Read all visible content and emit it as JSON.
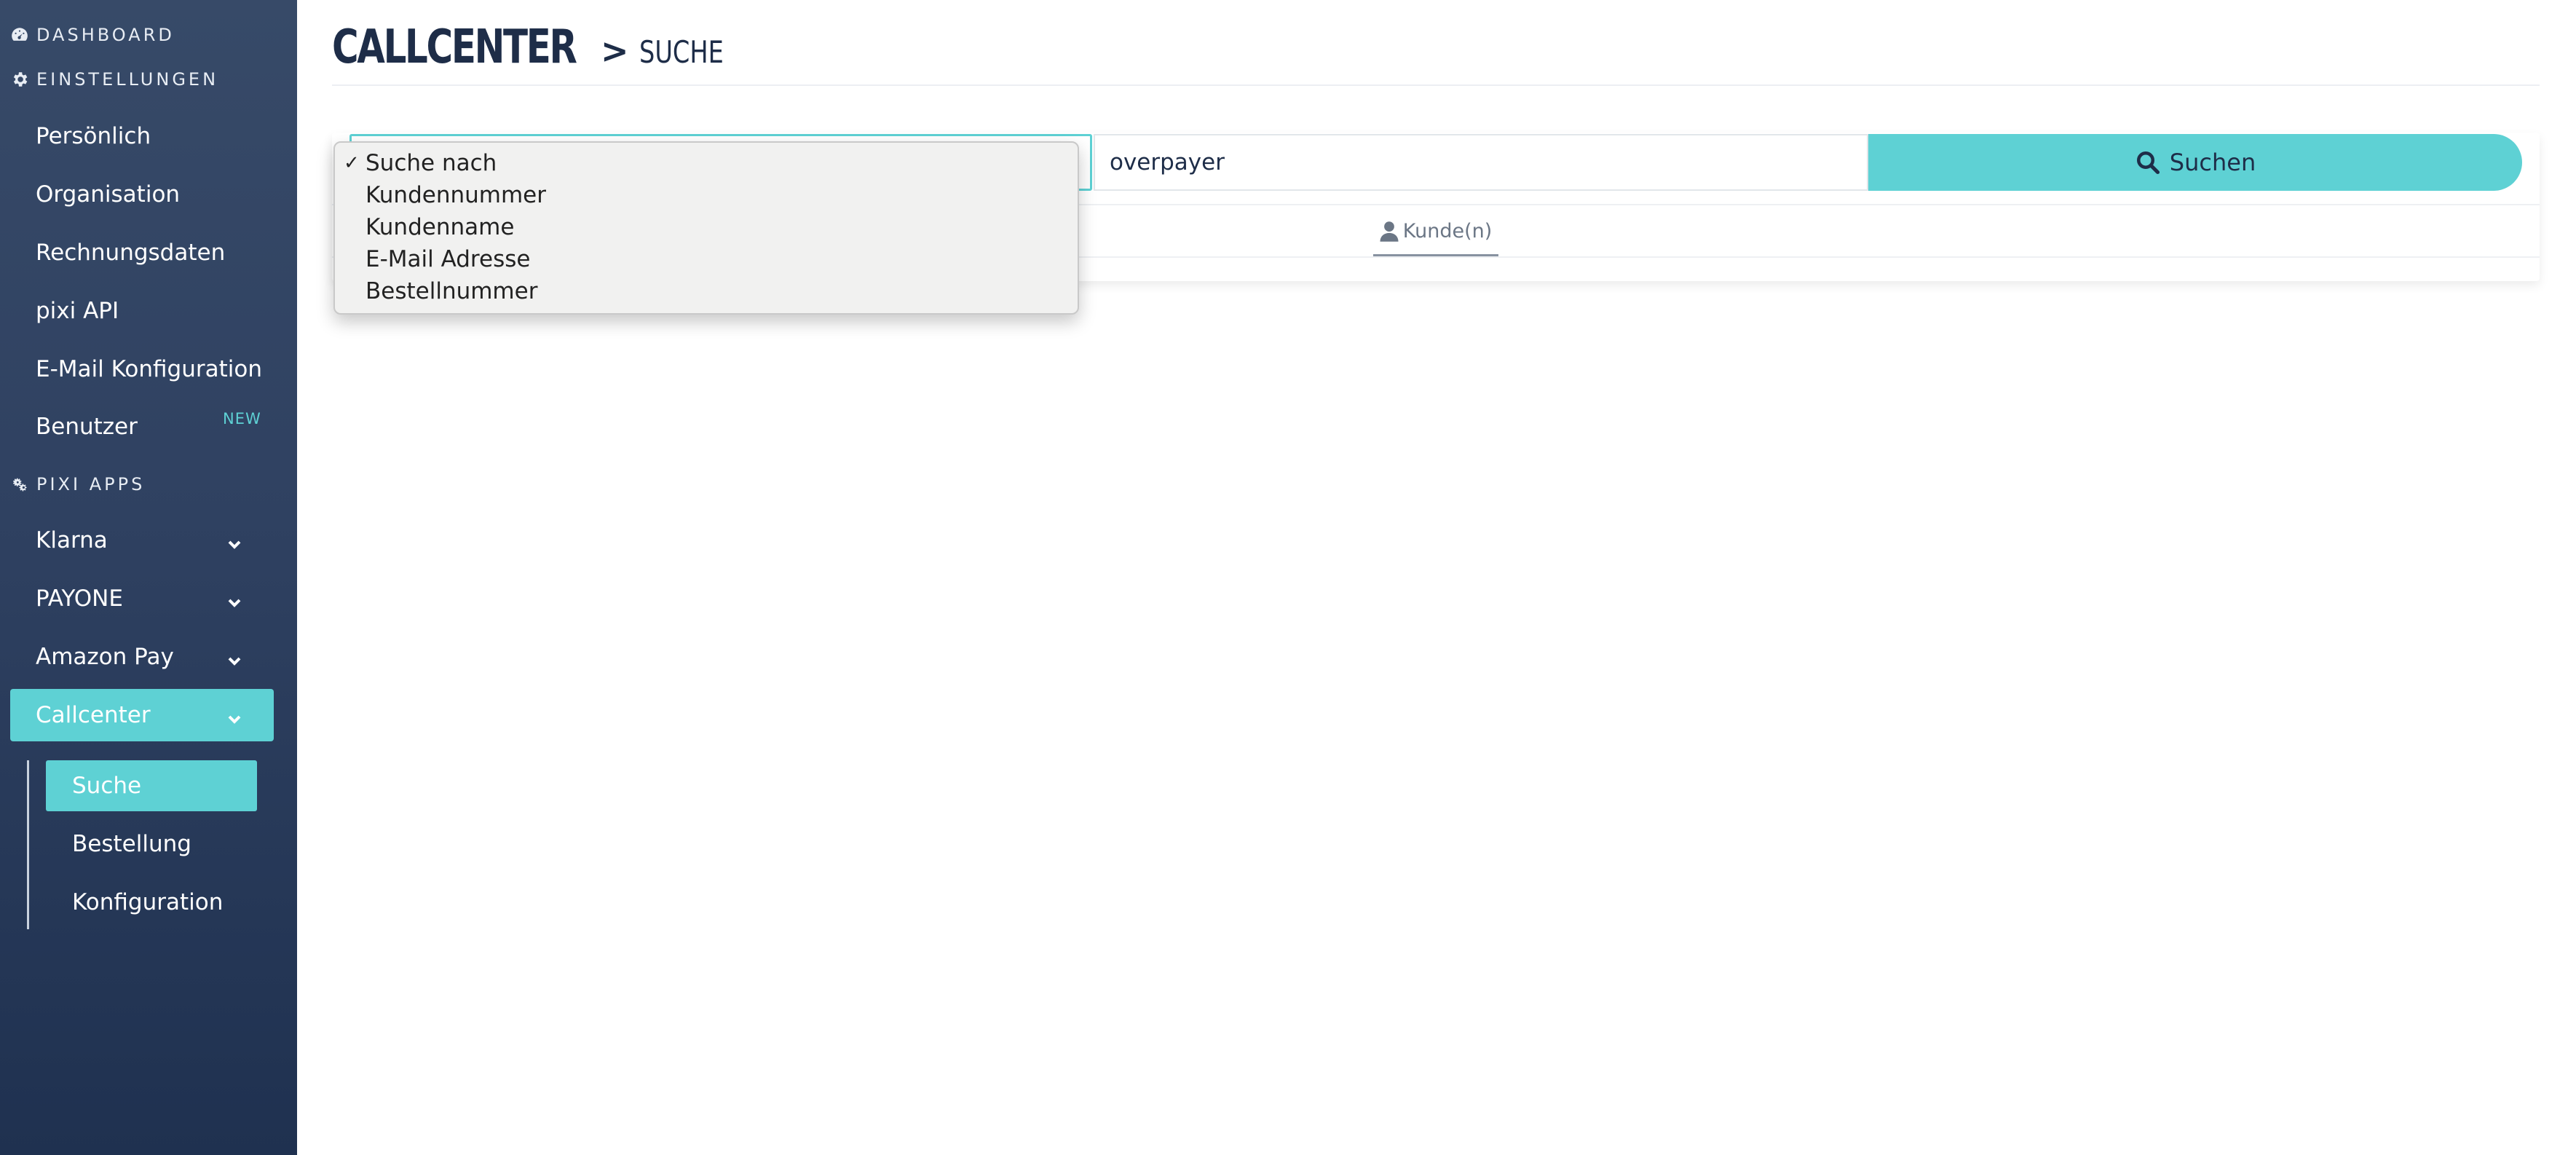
{
  "sidebar": {
    "dashboard": "DASHBOARD",
    "einstellungen": "EINSTELLUNGEN",
    "settings_items": [
      {
        "label": "Persönlich"
      },
      {
        "label": "Organisation"
      },
      {
        "label": "Rechnungsdaten"
      },
      {
        "label": "pixi API"
      },
      {
        "label": "E-Mail Konfiguration"
      },
      {
        "label": "Benutzer",
        "badge": "NEW"
      }
    ],
    "pixi_apps": "PIXI APPS",
    "app_items": [
      {
        "label": "Klarna"
      },
      {
        "label": "PAYONE"
      },
      {
        "label": "Amazon Pay"
      },
      {
        "label": "Callcenter"
      }
    ],
    "callcenter_sub": [
      {
        "label": "Suche"
      },
      {
        "label": "Bestellung"
      },
      {
        "label": "Konfiguration"
      }
    ]
  },
  "header": {
    "title": "CALLCENTER",
    "separator": ">",
    "subtitle": "SUCHE"
  },
  "search": {
    "query": "overpayer",
    "button_label": "Suchen",
    "select_options": [
      {
        "label": "Suche nach",
        "selected": true
      },
      {
        "label": "Kundennummer"
      },
      {
        "label": "Kundenname"
      },
      {
        "label": "E-Mail Adresse"
      },
      {
        "label": "Bestellnummer"
      }
    ],
    "check_mark": "✓"
  },
  "tabs": [
    {
      "label": "Kunde(n)"
    }
  ],
  "colors": {
    "accent": "#5ed1d4",
    "sidebar_bg": "#2f4161",
    "title": "#1e2d48"
  }
}
